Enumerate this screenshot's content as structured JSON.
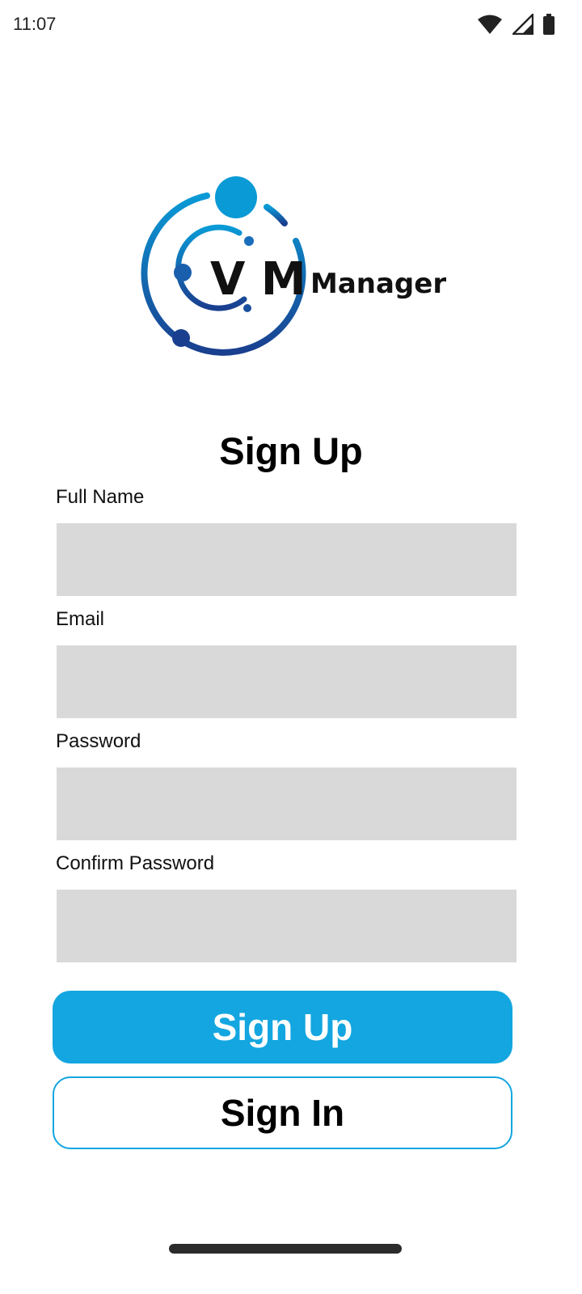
{
  "status_bar": {
    "time": "11:07",
    "icons": [
      "wifi-icon",
      "cellular-signal-icon",
      "battery-icon"
    ]
  },
  "logo": {
    "text_vm": "V M",
    "text_manager": "Manager",
    "colors": {
      "light": "#0a9ad6",
      "dark": "#1a3f8f"
    }
  },
  "form": {
    "title": "Sign Up",
    "fields": [
      {
        "label": "Full Name",
        "value": ""
      },
      {
        "label": "Email",
        "value": ""
      },
      {
        "label": "Password",
        "value": ""
      },
      {
        "label": "Confirm Password",
        "value": ""
      }
    ]
  },
  "buttons": {
    "sign_up": "Sign Up",
    "sign_in": "Sign In"
  },
  "colors": {
    "accent": "#13a6e0",
    "input_bg": "#d9d9d9"
  }
}
